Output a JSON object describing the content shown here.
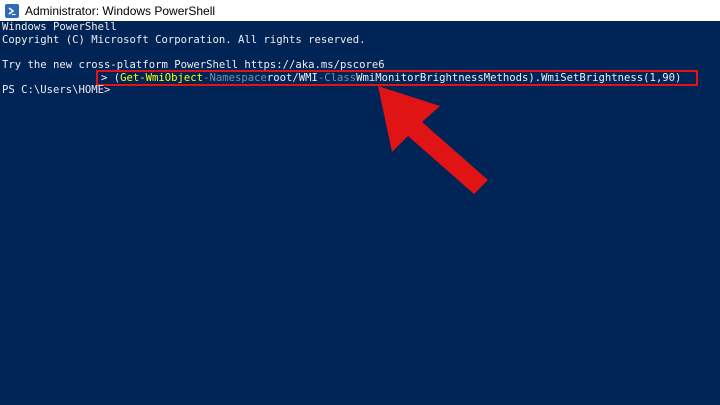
{
  "window": {
    "title": "Administrator: Windows PowerShell",
    "icon": "powershell-icon"
  },
  "console": {
    "lines": [
      "Windows PowerShell",
      "Copyright (C) Microsoft Corporation. All rights reserved.",
      "",
      "Try the new cross-platform PowerShell https://aka.ms/pscore6"
    ],
    "command": {
      "prefix": "> (",
      "cmdlet": "Get-WmiObject",
      "param1": "-Namespace",
      "arg1": "root/WMI",
      "param2": "-Class",
      "arg2": "WmiMonitorBrightnessMethods).WmiSetBrightness(1,90)"
    },
    "prompt": "PS C:\\Users\\HOME>"
  },
  "colors": {
    "background": "#012456",
    "foreground": "#eeedf0",
    "cmdlet": "#ffff00",
    "parameter": "#7a8ea8",
    "highlight": "#e01414"
  }
}
